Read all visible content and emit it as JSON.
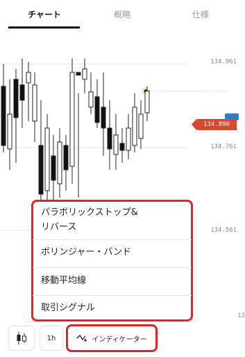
{
  "tabs": [
    {
      "label": "チャート",
      "active": true
    },
    {
      "label": "概略",
      "active": false
    },
    {
      "label": "仕様",
      "active": false
    }
  ],
  "chart": {
    "price_axis": [
      "134.961",
      "134.761",
      "134.561"
    ],
    "partial_axis_label": "12",
    "current_price": "134.890",
    "current_price_color": "#d9472f",
    "candle_color_down": "#111111",
    "candle_color_up": "#ffffff"
  },
  "indicator_menu": {
    "items": [
      {
        "label_line1": "パラボリックストップ&",
        "label_line2": "リバース"
      },
      {
        "label_line1": "ボリンジャー・バンド"
      },
      {
        "label_line1": "移動平均線"
      },
      {
        "label_line1": "取引シグナル"
      }
    ]
  },
  "toolbar": {
    "candles_icon": "candlestick-icon",
    "interval_label": "1h",
    "indicators_icon": "indicator-line-icon",
    "indicators_label": "インディケーター"
  }
}
